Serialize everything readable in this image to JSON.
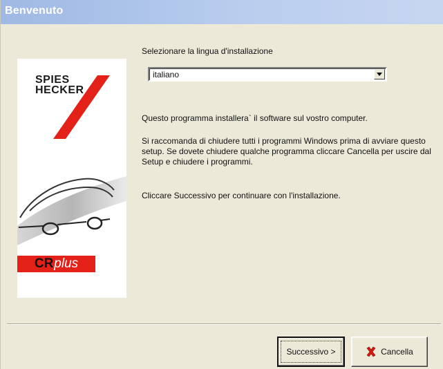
{
  "window": {
    "title": "Benvenuto"
  },
  "sidebar": {
    "brand": {
      "line1": "SPIES",
      "line2": "HECKER"
    },
    "badge": {
      "cr": "CR",
      "plus": "plus"
    },
    "icons": [
      "logo-slash-icon",
      "car-outline-icon"
    ]
  },
  "language": {
    "label": "Selezionare la lingua d'installazione",
    "selected": "italiano"
  },
  "body": {
    "paragraph1": "Questo programma installera` il software sul vostro computer.",
    "paragraph2": "Si raccomanda di chiudere tutti i programmi  Windows prima di avviare questo setup. Se dovete chiudere qualche programma cliccare Cancella per uscire dal Setup e chiudere i programmi.",
    "paragraph3": "Cliccare Successivo per continuare con l'installazione."
  },
  "buttons": {
    "next_label": "Successivo >",
    "cancel_label": "Cancella"
  },
  "colors": {
    "accent_red": "#e32119",
    "titlebar": "#9fb9e4",
    "dialog_bg": "#ece9d8"
  }
}
